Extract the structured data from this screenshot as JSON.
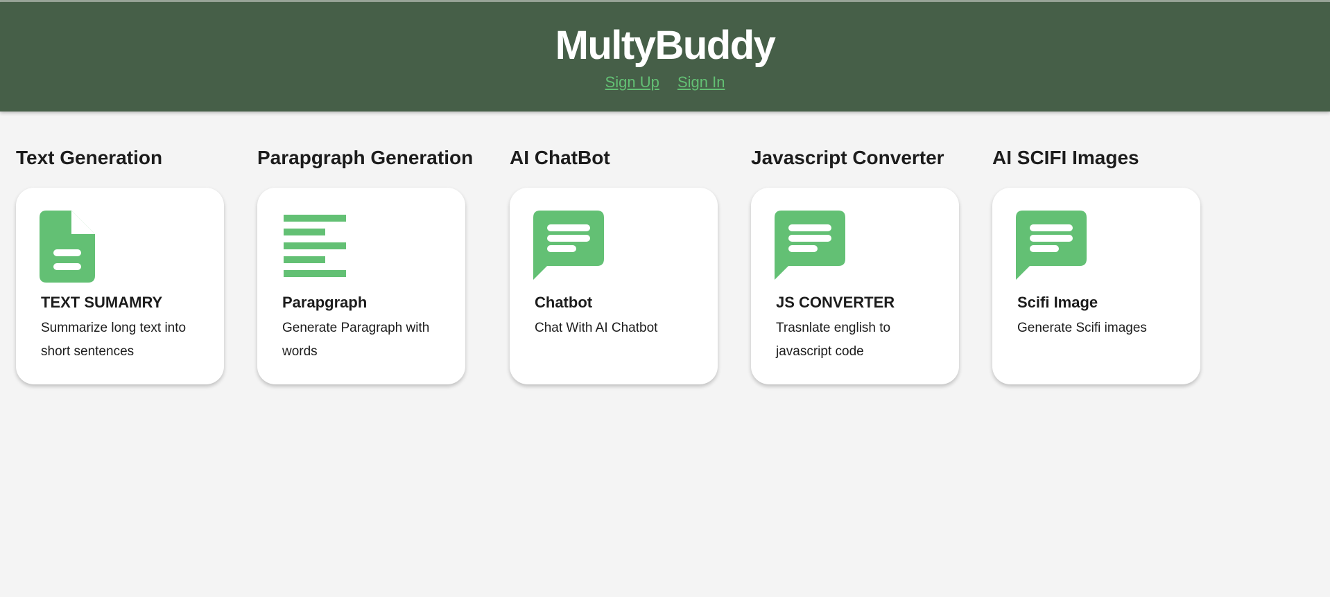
{
  "brand": {
    "title": "MultyBuddy"
  },
  "nav": {
    "sign_up": "Sign Up",
    "sign_in": "Sign In"
  },
  "colors": {
    "header_bg": "#465f48",
    "accent": "#63c074",
    "page_bg": "#f4f4f4"
  },
  "tools": [
    {
      "section": "Text Generation",
      "icon": "document-icon",
      "name": "TEXT SUMAMRY",
      "description": "Summarize long text into short sentences"
    },
    {
      "section": "Parapgraph Generation",
      "icon": "paragraph-icon",
      "name": "Parapgraph",
      "description": "Generate Paragraph with words"
    },
    {
      "section": "AI ChatBot",
      "icon": "chat-bubble-icon",
      "name": "Chatbot",
      "description": "Chat With AI Chatbot"
    },
    {
      "section": "Javascript Converter",
      "icon": "chat-bubble-icon",
      "name": "JS CONVERTER",
      "description": "Trasnlate english to javascript code"
    },
    {
      "section": "AI SCIFI Images",
      "icon": "chat-bubble-icon",
      "name": "Scifi Image",
      "description": "Generate Scifi images"
    }
  ]
}
